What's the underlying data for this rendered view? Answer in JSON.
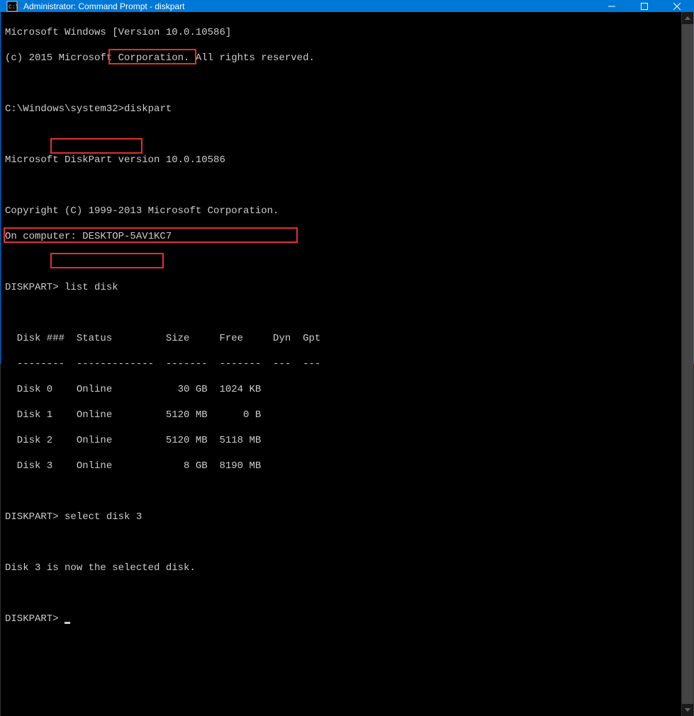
{
  "titlebar": {
    "title": "Administrator: Command Prompt - diskpart"
  },
  "terminal": {
    "prompt_path": "C:\\Windows\\system32>",
    "diskpart_prompt": "DISKPART>",
    "lines": {
      "winver": "Microsoft Windows [Version 10.0.10586]",
      "copyright1": "(c) 2015 Microsoft Corporation. All rights reserved.",
      "cmd_diskpart": "diskpart",
      "diskpart_ver": "Microsoft DiskPart version 10.0.10586",
      "copyright2": "Copyright (C) 1999-2013 Microsoft Corporation.",
      "computer": "On computer: DESKTOP-5AV1KC7",
      "cmd_listdisk": "list disk",
      "header": "  Disk ###  Status         Size     Free     Dyn  Gpt",
      "divider": "  --------  -------------  -------  -------  ---  ---",
      "disk0": "  Disk 0    Online           30 GB  1024 KB",
      "disk1": "  Disk 1    Online         5120 MB      0 B",
      "disk2": "  Disk 2    Online         5120 MB  5118 MB",
      "disk3": "  Disk 3    Online            8 GB  8190 MB",
      "cmd_select": "select disk 3",
      "selected_msg": "Disk 3 is now the selected disk."
    }
  }
}
